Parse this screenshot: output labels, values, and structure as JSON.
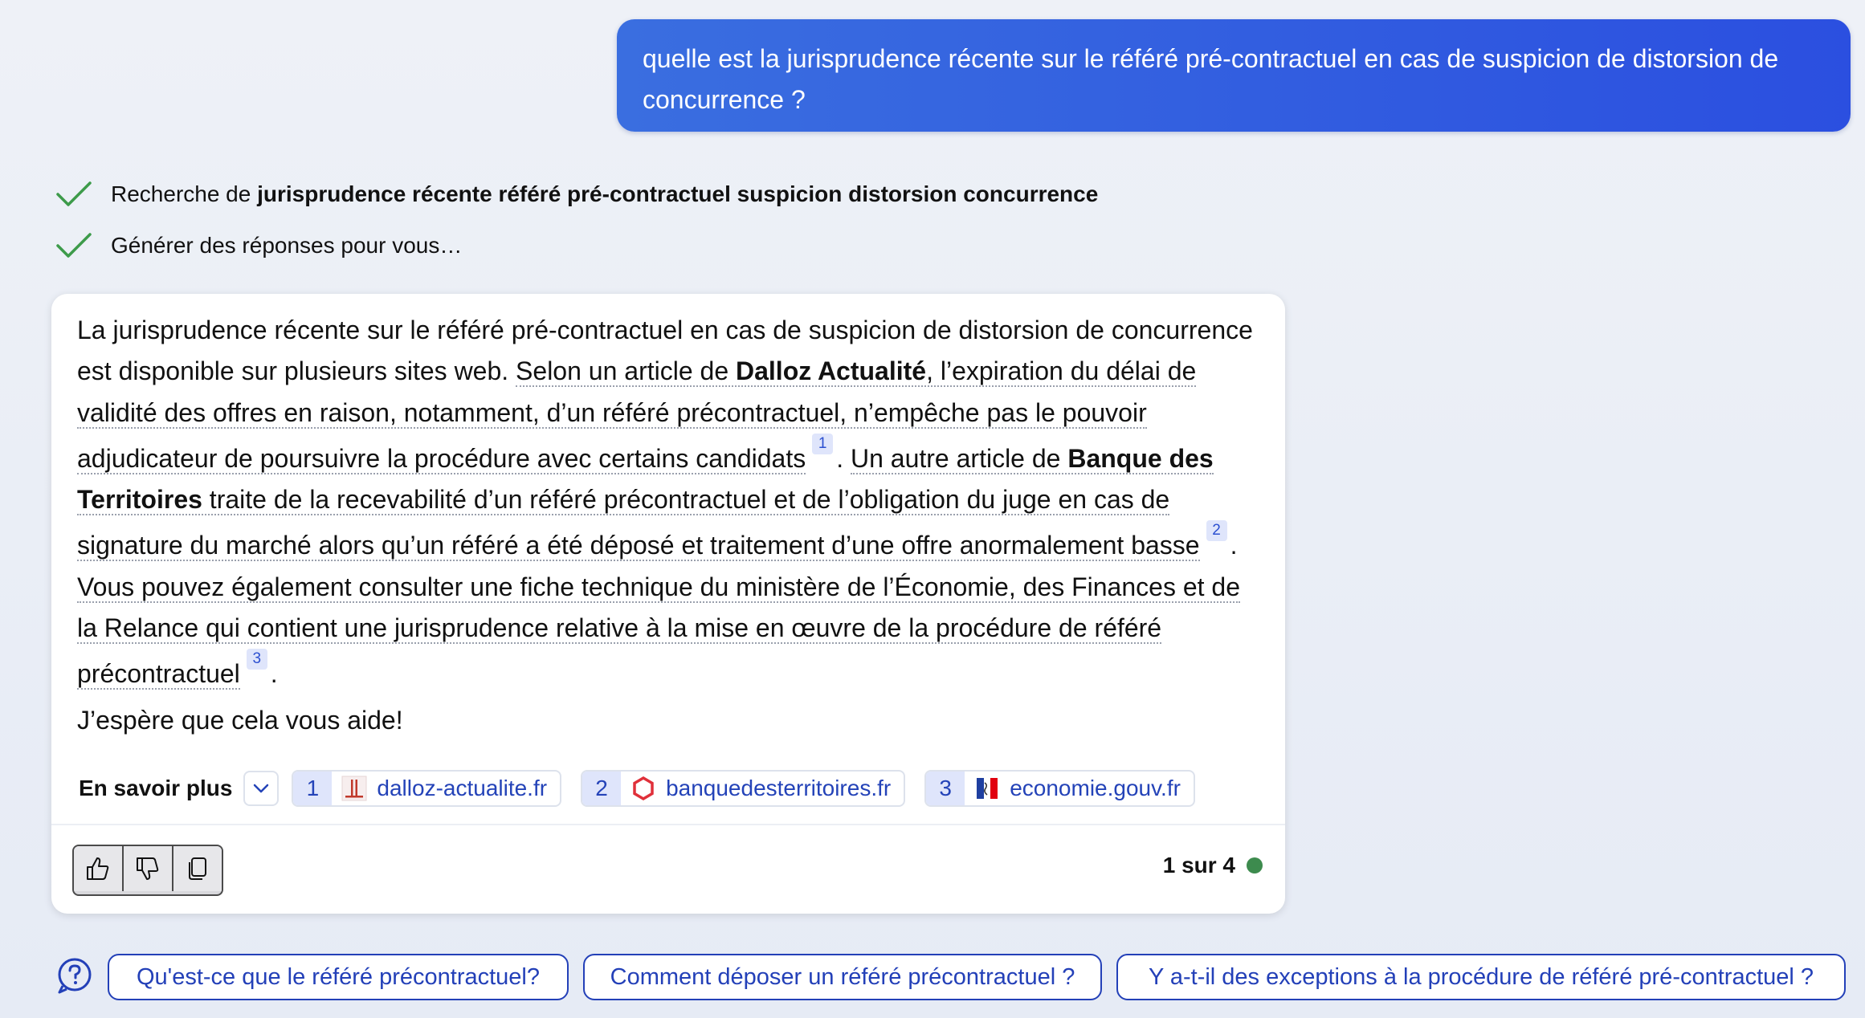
{
  "user_message": "quelle est la jurisprudence récente sur le référé pré-contractuel en cas de suspicion de distorsion de concurrence ?",
  "status": {
    "search_prefix": "Recherche de ",
    "search_query": "jurisprudence récente référé pré-contractuel suspicion distorsion concurrence",
    "generating": "Générer des réponses pour vous…"
  },
  "answer": {
    "t1": "La jurisprudence récente sur le référé pré-contractuel en cas de suspicion de distorsion de concurrence est disponible sur plusieurs sites web. ",
    "t2": "Selon un article de ",
    "t3": "Dalloz Actualité",
    "t4": ", l’expiration du délai de validité des offres en raison, notamment, d’un référé précontractuel, n’empêche pas le pouvoir adjudicateur de poursuivre la procédure avec certains candidats",
    "cite1": "1",
    "t5": ". ",
    "t6": "Un autre article de ",
    "t7": "Banque des Territoires",
    "t8": " traite de la recevabilité d’un référé précontractuel et de l’obligation du juge en cas de signature du marché alors qu’un référé a été déposé et traitement d’une offre anormalement basse",
    "cite2": "2",
    "t9": ". ",
    "t10": "Vous pouvez également consulter une fiche technique du ministère de l’Économie, des Finances et de la Relance qui contient une jurisprudence relative à la mise en œuvre de la procédure de référé précontractuel",
    "cite3": "3",
    "t11": ".",
    "closing": "J’espère que cela vous aide!"
  },
  "learn_more": {
    "label": "En savoir plus",
    "sources": [
      {
        "num": "1",
        "domain": "dalloz-actualite.fr",
        "icon": "dalloz-favicon"
      },
      {
        "num": "2",
        "domain": "banquedesterritoires.fr",
        "icon": "banque-territoires-favicon"
      },
      {
        "num": "3",
        "domain": "economie.gouv.fr",
        "icon": "marianne-favicon"
      }
    ]
  },
  "feedback": {
    "page_count": "1 sur 4",
    "status_color": "#3d8b4e"
  },
  "suggestions": [
    "Qu'est-ce que le référé précontractuel?",
    "Comment déposer un référé précontractuel ?",
    "Y a-t-il des exceptions à la procédure de référé pré-contractuel ?"
  ],
  "colors": {
    "accent": "#2b4fe0",
    "link": "#2443b8"
  }
}
